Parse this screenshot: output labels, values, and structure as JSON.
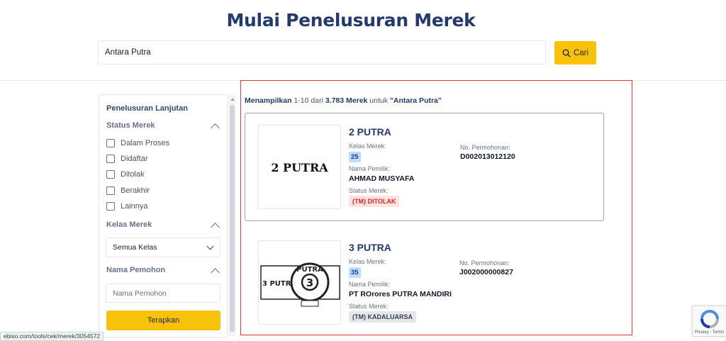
{
  "page": {
    "title": "Mulai Penelusuran Merek"
  },
  "search": {
    "value": "Antara Putra",
    "button_label": "Cari"
  },
  "sidebar": {
    "title": "Penelusuran Lanjutan",
    "status": {
      "label": "Status Merek",
      "options": [
        "Dalam Proses",
        "Didaftar",
        "Ditolak",
        "Berakhir",
        "Lainnya"
      ]
    },
    "kelas": {
      "label": "Kelas Merek",
      "selected": "Semua Kelas"
    },
    "pemohon": {
      "label": "Nama Pemohon",
      "placeholder": "Nama Pemohon"
    },
    "apply_label": "Terapkan"
  },
  "results": {
    "summary": {
      "prefix": "Menampilkan",
      "range": "1-10 dari",
      "count": "3.783 Merek",
      "middle": "untuk",
      "query": "\"Antara Putra\""
    },
    "labels": {
      "kelas": "Kelas Merek:",
      "pemilik": "Nama Pemilik:",
      "status": "Status Merek:",
      "permohonan": "No. Permohonan:"
    },
    "items": [
      {
        "title": "2 PUTRA",
        "mark_text": "2 PUTRA",
        "kelas": "25",
        "pemilik": "AHMAD MUSYAFA",
        "status": "(TM) DITOLAK",
        "status_color": "#dc2626",
        "no_permohonan": "D002013012120"
      },
      {
        "title": "3 PUTRA",
        "mark_text": "3 PUTRA",
        "logo_text": "PUTRA",
        "logo_numeral": "3",
        "kelas": "35",
        "pemilik": "PT ROrores PUTRA MANDIRI",
        "status": "(TM) KADALUARSA",
        "status_color": "#374151",
        "no_permohonan": "J002000000827"
      }
    ]
  },
  "footer": {
    "status_url": "ebiso.com/tools/cek/merek/3054572",
    "recaptcha_text": "Privacy - Terms"
  },
  "colors": {
    "brand": "#233a6b",
    "accent": "#f8c20a",
    "frame": "#d63a3a"
  }
}
